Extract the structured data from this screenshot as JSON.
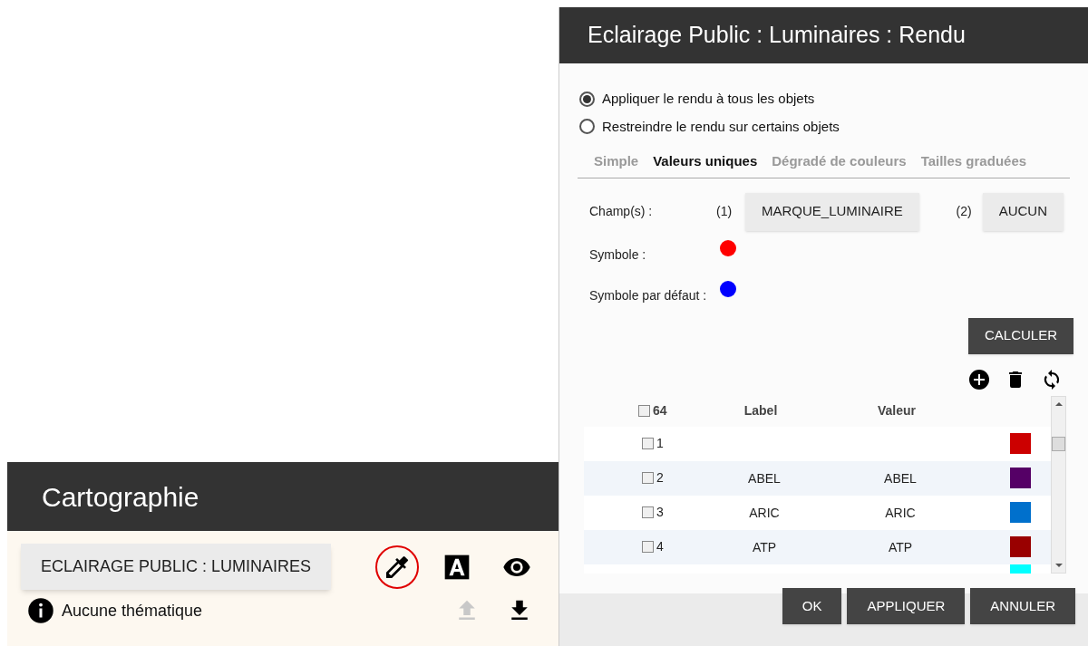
{
  "cartography_panel": {
    "title": "Cartographie",
    "layer_button": "ECLAIRAGE PUBLIC : LUMINAIRES",
    "status": "Aucune thématique",
    "tools": [
      {
        "kind": "dropper",
        "highlighted": true
      },
      {
        "kind": "label",
        "highlighted": false
      },
      {
        "kind": "eye",
        "highlighted": false
      }
    ],
    "actions": [
      {
        "kind": "upload",
        "disabled": true
      },
      {
        "kind": "download",
        "disabled": false
      }
    ]
  },
  "render_dialog": {
    "title": "Eclairage Public : Luminaires : Rendu",
    "scope_options": [
      {
        "label": "Appliquer le rendu à tous les objets",
        "selected": true
      },
      {
        "label": "Restreindre le rendu sur certains objets",
        "selected": false
      }
    ],
    "tabs": [
      {
        "label": "Simple",
        "selected": false
      },
      {
        "label": "Valeurs uniques",
        "selected": true
      },
      {
        "label": "Dégradé de couleurs",
        "selected": false
      },
      {
        "label": "Tailles graduées",
        "selected": false
      }
    ],
    "fields_label": "Champ(s) :",
    "field_1_index": "(1)",
    "field_1": "MARQUE_LUMINAIRE",
    "field_2_index": "(2)",
    "field_2": "AUCUN",
    "symbols": [
      {
        "label": "Symbole :",
        "color": "#ff0000"
      },
      {
        "label": "Symbole par défaut :",
        "color": "#0000ff"
      }
    ],
    "calculate_button": "CALCULER",
    "table": {
      "count": "64",
      "all_checked": false,
      "columns": [
        "Label",
        "Valeur"
      ],
      "rows": [
        {
          "number": "1",
          "label": "",
          "value": "",
          "checked": false,
          "color": "#cc0000"
        },
        {
          "number": "2",
          "label": "ABEL",
          "value": "ABEL",
          "checked": false,
          "color": "#550066"
        },
        {
          "number": "3",
          "label": "ARIC",
          "value": "ARIC",
          "checked": false,
          "color": "#0070cc"
        },
        {
          "number": "4",
          "label": "ATP",
          "value": "ATP",
          "checked": false,
          "color": "#990000"
        },
        {
          "color": "#00ffff"
        }
      ]
    },
    "buttons": [
      "OK",
      "APPLIQUER",
      "ANNULER"
    ]
  }
}
